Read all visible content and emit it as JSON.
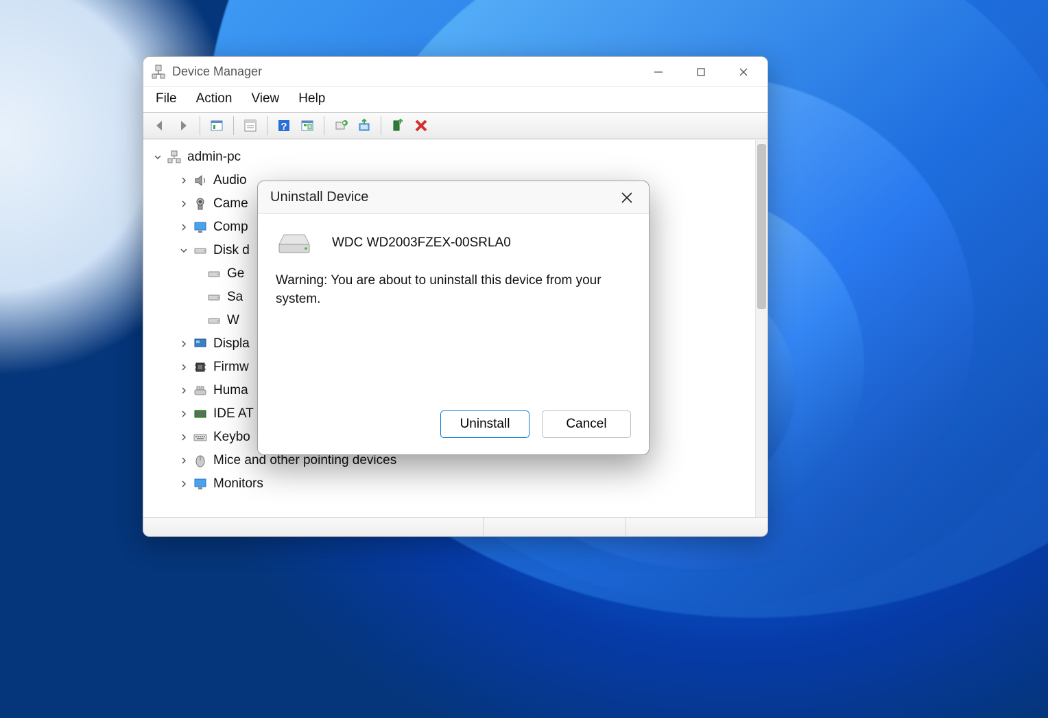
{
  "window": {
    "title": "Device Manager",
    "menu": {
      "file": "File",
      "action": "Action",
      "view": "View",
      "help": "Help"
    }
  },
  "toolbar_icons": {
    "back": "back-arrow-icon",
    "forward": "forward-arrow-icon",
    "show_all": "show-all-icon",
    "properties": "properties-icon",
    "help": "help-icon",
    "details": "details-icon",
    "scan": "scan-hardware-icon",
    "update": "update-driver-icon",
    "uninstall": "uninstall-device-icon",
    "disable": "disable-device-icon"
  },
  "tree": {
    "root": "admin-pc",
    "items": [
      {
        "label": "Audio",
        "icon": "speaker"
      },
      {
        "label": "Came",
        "icon": "camera"
      },
      {
        "label": "Comp",
        "icon": "monitor"
      },
      {
        "label": "Disk d",
        "icon": "drive",
        "expanded": true,
        "children": [
          {
            "label": "Ge",
            "icon": "drive"
          },
          {
            "label": "Sa",
            "icon": "drive"
          },
          {
            "label": "W",
            "icon": "drive"
          }
        ]
      },
      {
        "label": "Displa",
        "icon": "display-adapter"
      },
      {
        "label": "Firmw",
        "icon": "chip"
      },
      {
        "label": "Huma",
        "icon": "hid"
      },
      {
        "label": "IDE AT",
        "icon": "ide"
      },
      {
        "label": "Keybo",
        "icon": "keyboard"
      },
      {
        "label": "Mice and other pointing devices",
        "icon": "mouse"
      },
      {
        "label": "Monitors",
        "icon": "monitor"
      }
    ]
  },
  "dialog": {
    "title": "Uninstall Device",
    "device": "WDC WD2003FZEX-00SRLA0",
    "warning": "Warning: You are about to uninstall this device from your system.",
    "uninstall": "Uninstall",
    "cancel": "Cancel"
  }
}
